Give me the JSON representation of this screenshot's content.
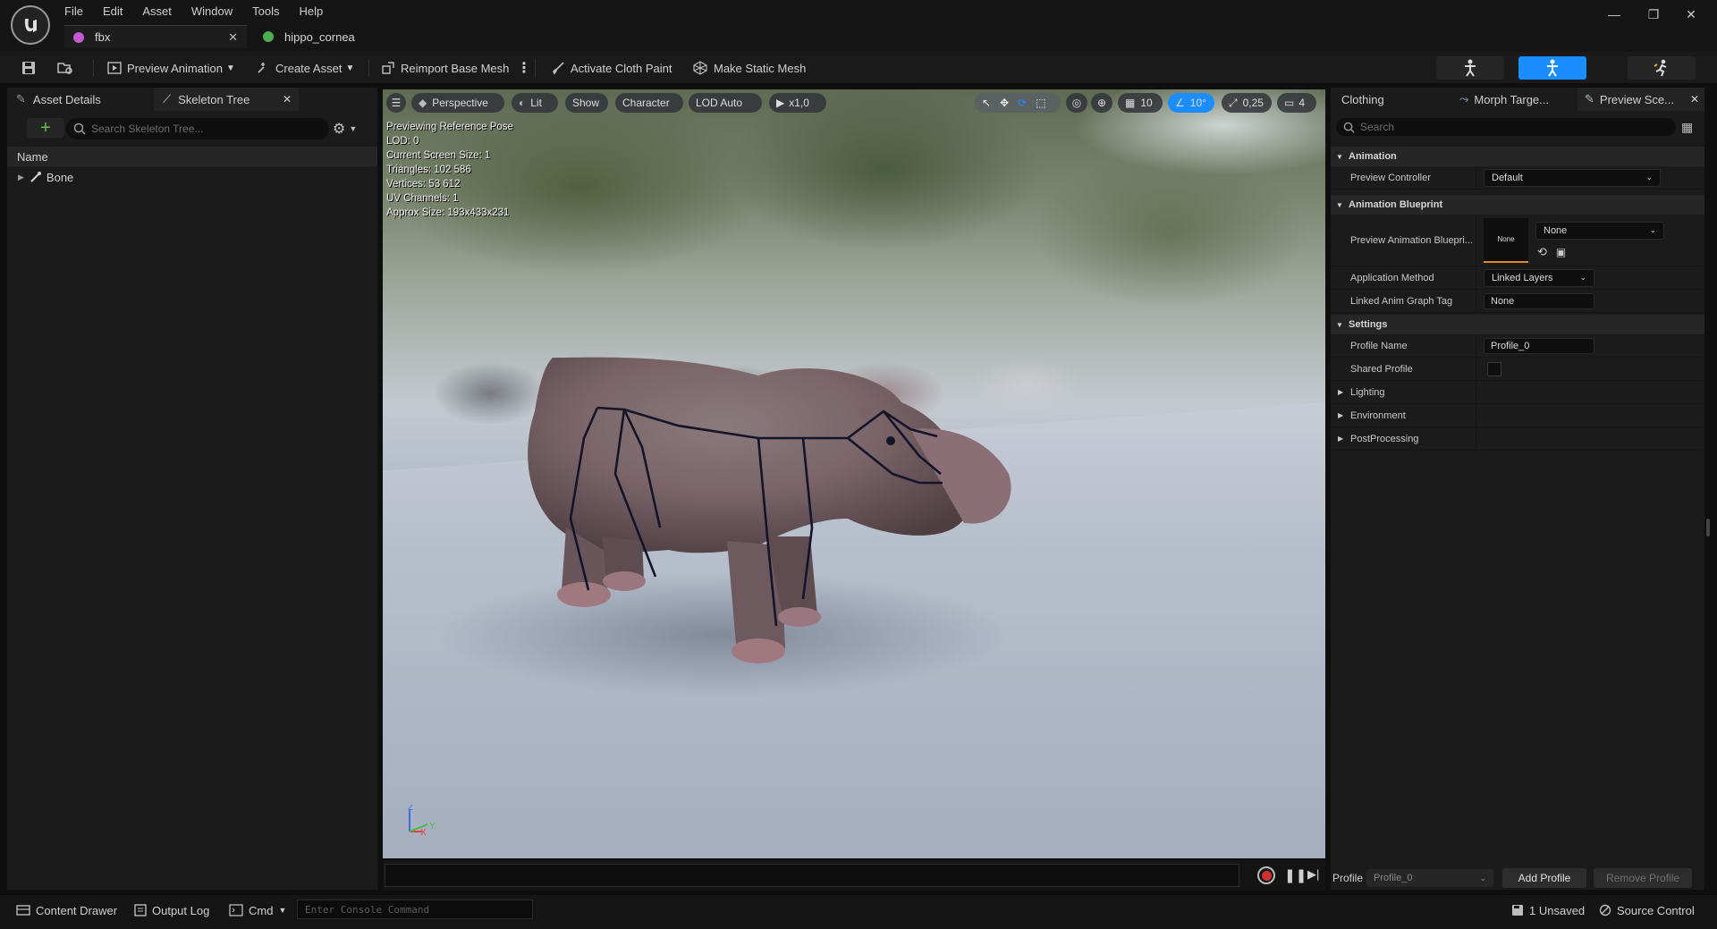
{
  "menu": [
    "File",
    "Edit",
    "Asset",
    "Window",
    "Tools",
    "Help"
  ],
  "doc_tabs": [
    {
      "label": "fbx",
      "color": "#c25ad0"
    },
    {
      "label": "hippo_cornea",
      "color": "#4caf50"
    }
  ],
  "toolbar": {
    "preview_animation": "Preview Animation",
    "create_asset": "Create Asset",
    "reimport_base_mesh": "Reimport Base Mesh",
    "activate_cloth_paint": "Activate Cloth Paint",
    "make_static_mesh": "Make Static Mesh",
    "active_mode_color": "#1b8dff"
  },
  "left_panel": {
    "tabs": [
      "Asset Details",
      "Skeleton Tree"
    ],
    "search_placeholder": "Search Skeleton Tree...",
    "column_name": "Name",
    "root_bone": "Bone"
  },
  "viewport": {
    "view_mode": "Perspective",
    "lighting": "Lit",
    "show": "Show",
    "character": "Character",
    "lod": "LOD Auto",
    "play_speed": "x1,0",
    "grid_snap": "10",
    "rotation_snap": "10°",
    "scale_snap": "0,25",
    "camera_speed": "4",
    "stats": [
      "Previewing Reference Pose",
      "LOD: 0",
      "Current Screen Size: 1",
      "Triangles: 102 586",
      "Vertices: 53 612",
      "UV Channels: 1",
      "Approx Size: 193x433x231"
    ],
    "axis": {
      "z": "Z",
      "x": "X",
      "y": "Y"
    }
  },
  "right_panel": {
    "tabs": [
      "Clothing",
      "Morph Targe...",
      "Preview Sce..."
    ],
    "search_placeholder": "Search",
    "sections": {
      "animation": "Animation",
      "animation_blueprint": "Animation Blueprint",
      "settings": "Settings"
    },
    "props": {
      "preview_controller": {
        "label": "Preview Controller",
        "value": "Default"
      },
      "preview_anim_bp": {
        "label": "Preview Animation Bluepri...",
        "thumb": "None",
        "value": "None"
      },
      "application_method": {
        "label": "Application Method",
        "value": "Linked Layers"
      },
      "linked_anim_tag": {
        "label": "Linked Anim Graph Tag",
        "value": "None"
      },
      "profile_name": {
        "label": "Profile Name",
        "value": "Profile_0"
      },
      "shared_profile": {
        "label": "Shared Profile",
        "checked": false
      }
    },
    "collapsed": [
      "Lighting",
      "Environment",
      "PostProcessing"
    ],
    "profile_label": "Profile",
    "profile_value": "Profile_0",
    "add_profile": "Add Profile",
    "remove_profile": "Remove Profile"
  },
  "statusbar": {
    "content_drawer": "Content Drawer",
    "output_log": "Output Log",
    "cmd": "Cmd",
    "console_placeholder": "Enter Console Command",
    "unsaved": "1 Unsaved",
    "source_control": "Source Control"
  }
}
